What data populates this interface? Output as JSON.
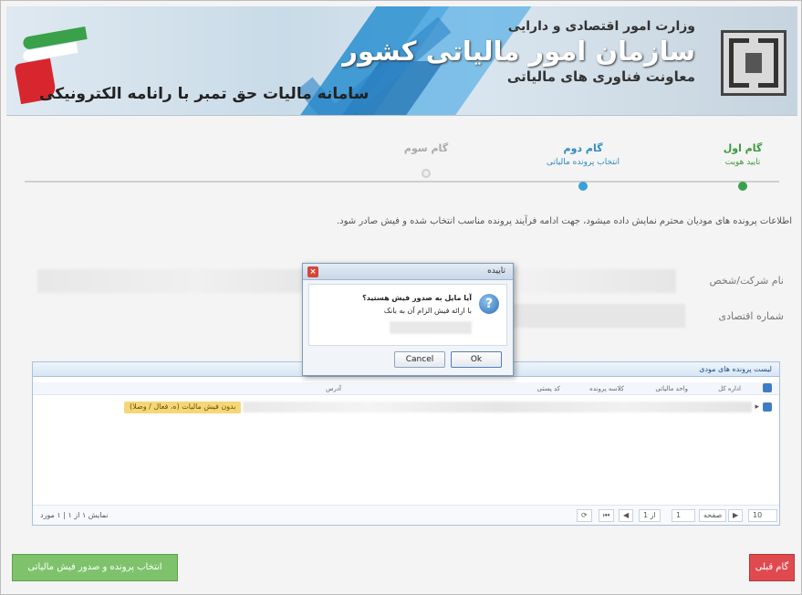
{
  "header": {
    "system_title": "سامانه مالیات حق تمبر با رانامه الکترونیکی",
    "ministry": "وزارت امور اقتصادی و دارایی",
    "org_name": "سازمان امور مالیاتی کشور",
    "deputy": "معاونت فناوری های مالیاتی"
  },
  "steps": [
    {
      "title": "گام اول",
      "subtitle": "تایید هویت",
      "state": "done"
    },
    {
      "title": "گام دوم",
      "subtitle": "انتخاب پرونده مالیاتی",
      "state": "active"
    },
    {
      "title": "گام سوم",
      "subtitle": "",
      "state": "pending"
    }
  ],
  "instruction": "اطلاعات پرونده های مودیان محترم نمایش داده میشود، جهت ادامه فرآیند پرونده مناسب انتخاب شده و فیش صادر شود.",
  "info": {
    "company_label": "نام شرکت/شخص",
    "economic_label": "شماره اقتصادی"
  },
  "table": {
    "title": "لیست پرونده های مودی",
    "columns": [
      "اداره کل",
      "واحد مالیاتی",
      "کلاسه پرونده",
      "کد پستی",
      "آدرس"
    ],
    "row_badge": "بدون فیش مالیات (ه، فعال / وصلا)",
    "pager_info": "نمایش ۱ از ۱ | ۱ مورد",
    "page_label": "صفحه",
    "page_value": "1",
    "of_label": "از 1",
    "page_size": "10"
  },
  "dialog": {
    "title": "تاییده",
    "question": "آیا مایل به صدور فیش هستید؟",
    "note": "با ارائه فیش الزام آن به بانک",
    "cancel_label": "Cancel",
    "ok_label": "Ok"
  },
  "actions": {
    "next_label": "انتخاب پرونده و صدور فیش مالیاتی",
    "prev_label": "گام قبلی"
  },
  "colors": {
    "next_button": "#7ec36b",
    "prev_button": "#e04a4f",
    "step_done": "#3aa14a",
    "step_active": "#3aa0d8"
  }
}
